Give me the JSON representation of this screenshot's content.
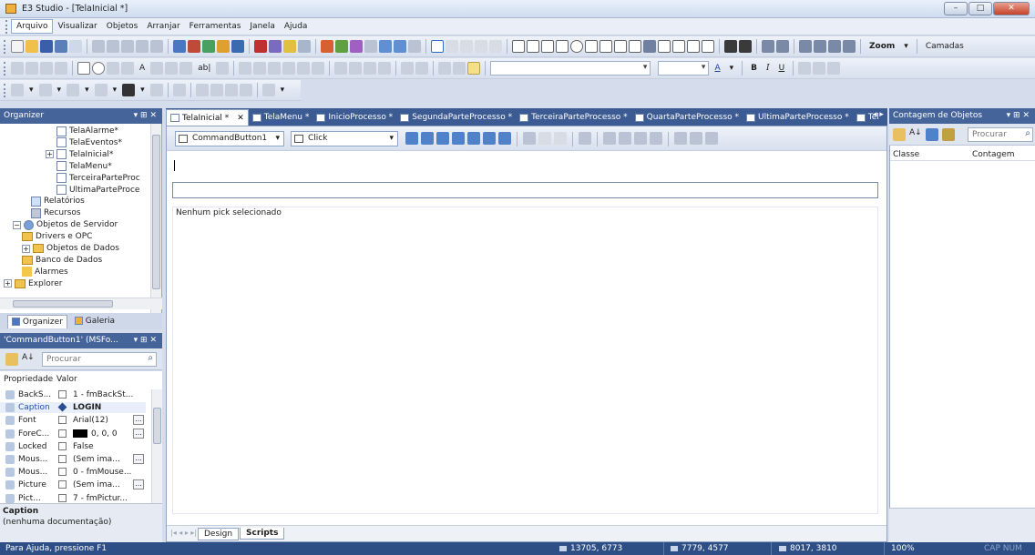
{
  "window": {
    "title": "E3 Studio - [TelaInicial *]"
  },
  "menu": [
    "Arquivo",
    "Visualizar",
    "Objetos",
    "Arranjar",
    "Ferramentas",
    "Janela",
    "Ajuda"
  ],
  "toolbar": {
    "zoom_label": "Zoom",
    "camadas_label": "Camadas"
  },
  "organizer": {
    "header": "Organizer",
    "items": [
      {
        "label": "TelaAlarme*",
        "level": 4,
        "icon": "screen",
        "expander": ""
      },
      {
        "label": "TelaEventos*",
        "level": 4,
        "icon": "screen",
        "expander": ""
      },
      {
        "label": "TelaInicial*",
        "level": 4,
        "icon": "screen",
        "expander": "+"
      },
      {
        "label": "TelaMenu*",
        "level": 4,
        "icon": "screen",
        "expander": ""
      },
      {
        "label": "TerceiraParteProc",
        "level": 4,
        "icon": "screen",
        "expander": ""
      },
      {
        "label": "UltimaParteProce",
        "level": 4,
        "icon": "screen",
        "expander": ""
      },
      {
        "label": "Relatórios",
        "level": 3,
        "icon": "report",
        "expander": ""
      },
      {
        "label": "Recursos",
        "level": 3,
        "icon": "resource",
        "expander": ""
      },
      {
        "label": "Objetos de Servidor",
        "level": 1,
        "icon": "server",
        "expander": "−"
      },
      {
        "label": "Drivers e OPC",
        "level": 2,
        "icon": "folder",
        "expander": ""
      },
      {
        "label": "Objetos de Dados",
        "level": 2,
        "icon": "folder",
        "expander": "+"
      },
      {
        "label": "Banco de Dados",
        "level": 2,
        "icon": "folder",
        "expander": ""
      },
      {
        "label": "Alarmes",
        "level": 2,
        "icon": "alarm",
        "expander": ""
      },
      {
        "label": "Explorer",
        "level": 0,
        "icon": "folder",
        "expander": "+"
      }
    ],
    "tabs": [
      "Organizer",
      "Galeria"
    ]
  },
  "properties": {
    "header": "'CommandButton1' (MSFo...",
    "search_placeholder": "Procurar",
    "col_prop": "Propriedade",
    "col_val": "Valor",
    "rows": [
      {
        "name": "BackS...",
        "value": "1 - fmBackSt...",
        "bold": false,
        "ellipsis": false,
        "swatch": ""
      },
      {
        "name": "Caption",
        "value": "LOGIN",
        "bold": true,
        "ellipsis": false,
        "swatch": ""
      },
      {
        "name": "Font",
        "value": "Arial(12)",
        "bold": false,
        "ellipsis": true,
        "swatch": ""
      },
      {
        "name": "ForeC...",
        "value": "0, 0, 0",
        "bold": false,
        "ellipsis": true,
        "swatch": "#000000"
      },
      {
        "name": "Locked",
        "value": "False",
        "bold": false,
        "ellipsis": false,
        "swatch": ""
      },
      {
        "name": "Mous...",
        "value": "(Sem ima...",
        "bold": false,
        "ellipsis": true,
        "swatch": ""
      },
      {
        "name": "Mous...",
        "value": "0 - fmMouse...",
        "bold": false,
        "ellipsis": false,
        "swatch": ""
      },
      {
        "name": "Picture",
        "value": "(Sem ima...",
        "bold": false,
        "ellipsis": true,
        "swatch": ""
      },
      {
        "name": "Pict...",
        "value": "7 - fmPictur...",
        "bold": false,
        "ellipsis": false,
        "swatch": ""
      }
    ],
    "desc_title": "Caption",
    "desc_text": "(nenhuma documentação)"
  },
  "doc_tabs": [
    {
      "label": "TelaInicial *",
      "selected": true
    },
    {
      "label": "TelaMenu *",
      "selected": false
    },
    {
      "label": "InicioProcesso *",
      "selected": false
    },
    {
      "label": "SegundaParteProcesso *",
      "selected": false
    },
    {
      "label": "TerceiraParteProcesso *",
      "selected": false
    },
    {
      "label": "QuartaParteProcesso *",
      "selected": false
    },
    {
      "label": "UltimaParteProcesso *",
      "selected": false
    },
    {
      "label": "Tel",
      "selected": false
    }
  ],
  "script_editor": {
    "object_combo": "CommandButton1",
    "event_combo": "Click",
    "pick_status": "Nenhum pick selecionado",
    "bottom_tabs": [
      "Design",
      "Scripts"
    ]
  },
  "contagem": {
    "header": "Contagem de Objetos",
    "search_placeholder": "Procurar",
    "col_classe": "Classe",
    "col_contagem": "Contagem"
  },
  "status": {
    "help": "Para Ajuda, pressione F1",
    "coord1": "13705, 6773",
    "coord2": "7779, 4577",
    "coord3": "8017, 3810",
    "zoom": "100%",
    "keys": "CAP NUM SCR"
  }
}
